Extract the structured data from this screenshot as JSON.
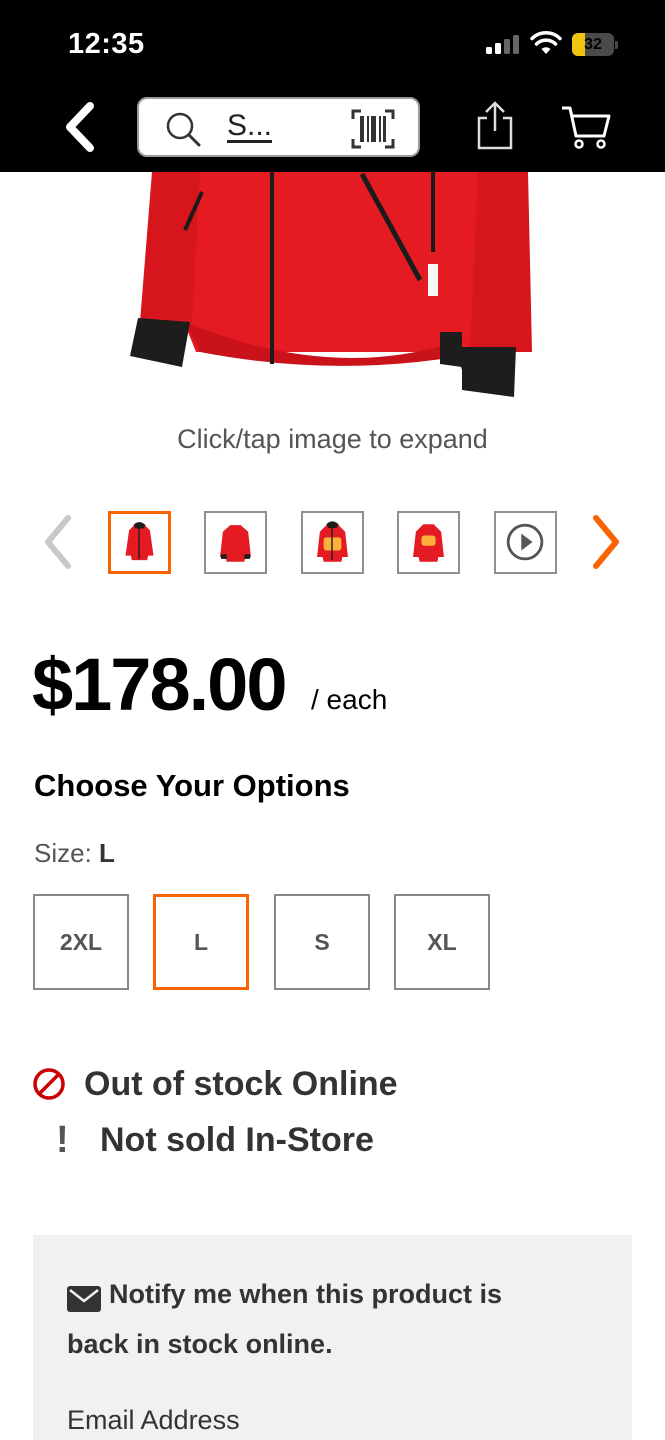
{
  "status_bar": {
    "time": "12:35",
    "battery_level": "32",
    "battery_fraction": 0.32
  },
  "nav": {
    "search_text": "S...",
    "icons": [
      "back-chevron-icon",
      "search-icon",
      "barcode-scan-icon",
      "share-icon",
      "cart-icon"
    ]
  },
  "gallery": {
    "expand_hint": "Click/tap image to expand",
    "thumbnail_count": 5,
    "active_thumbnail": 1
  },
  "price": {
    "amount": "$178.00",
    "unit": "/ each"
  },
  "options": {
    "title": "Choose Your Options",
    "size_prefix": "Size:",
    "size_value": "L",
    "sizes": [
      "2XL",
      "L",
      "S",
      "XL"
    ],
    "selected_size": "L"
  },
  "availability": {
    "online": "Out of stock Online",
    "in_store": "Not sold In-Store"
  },
  "notify": {
    "line1": "Notify me when this product is",
    "line2": "back in stock online.",
    "email_label": "Email Address"
  },
  "colors": {
    "accent": "#f96302",
    "jacket": "#e41b23",
    "out_of_stock": "#cc0000"
  }
}
